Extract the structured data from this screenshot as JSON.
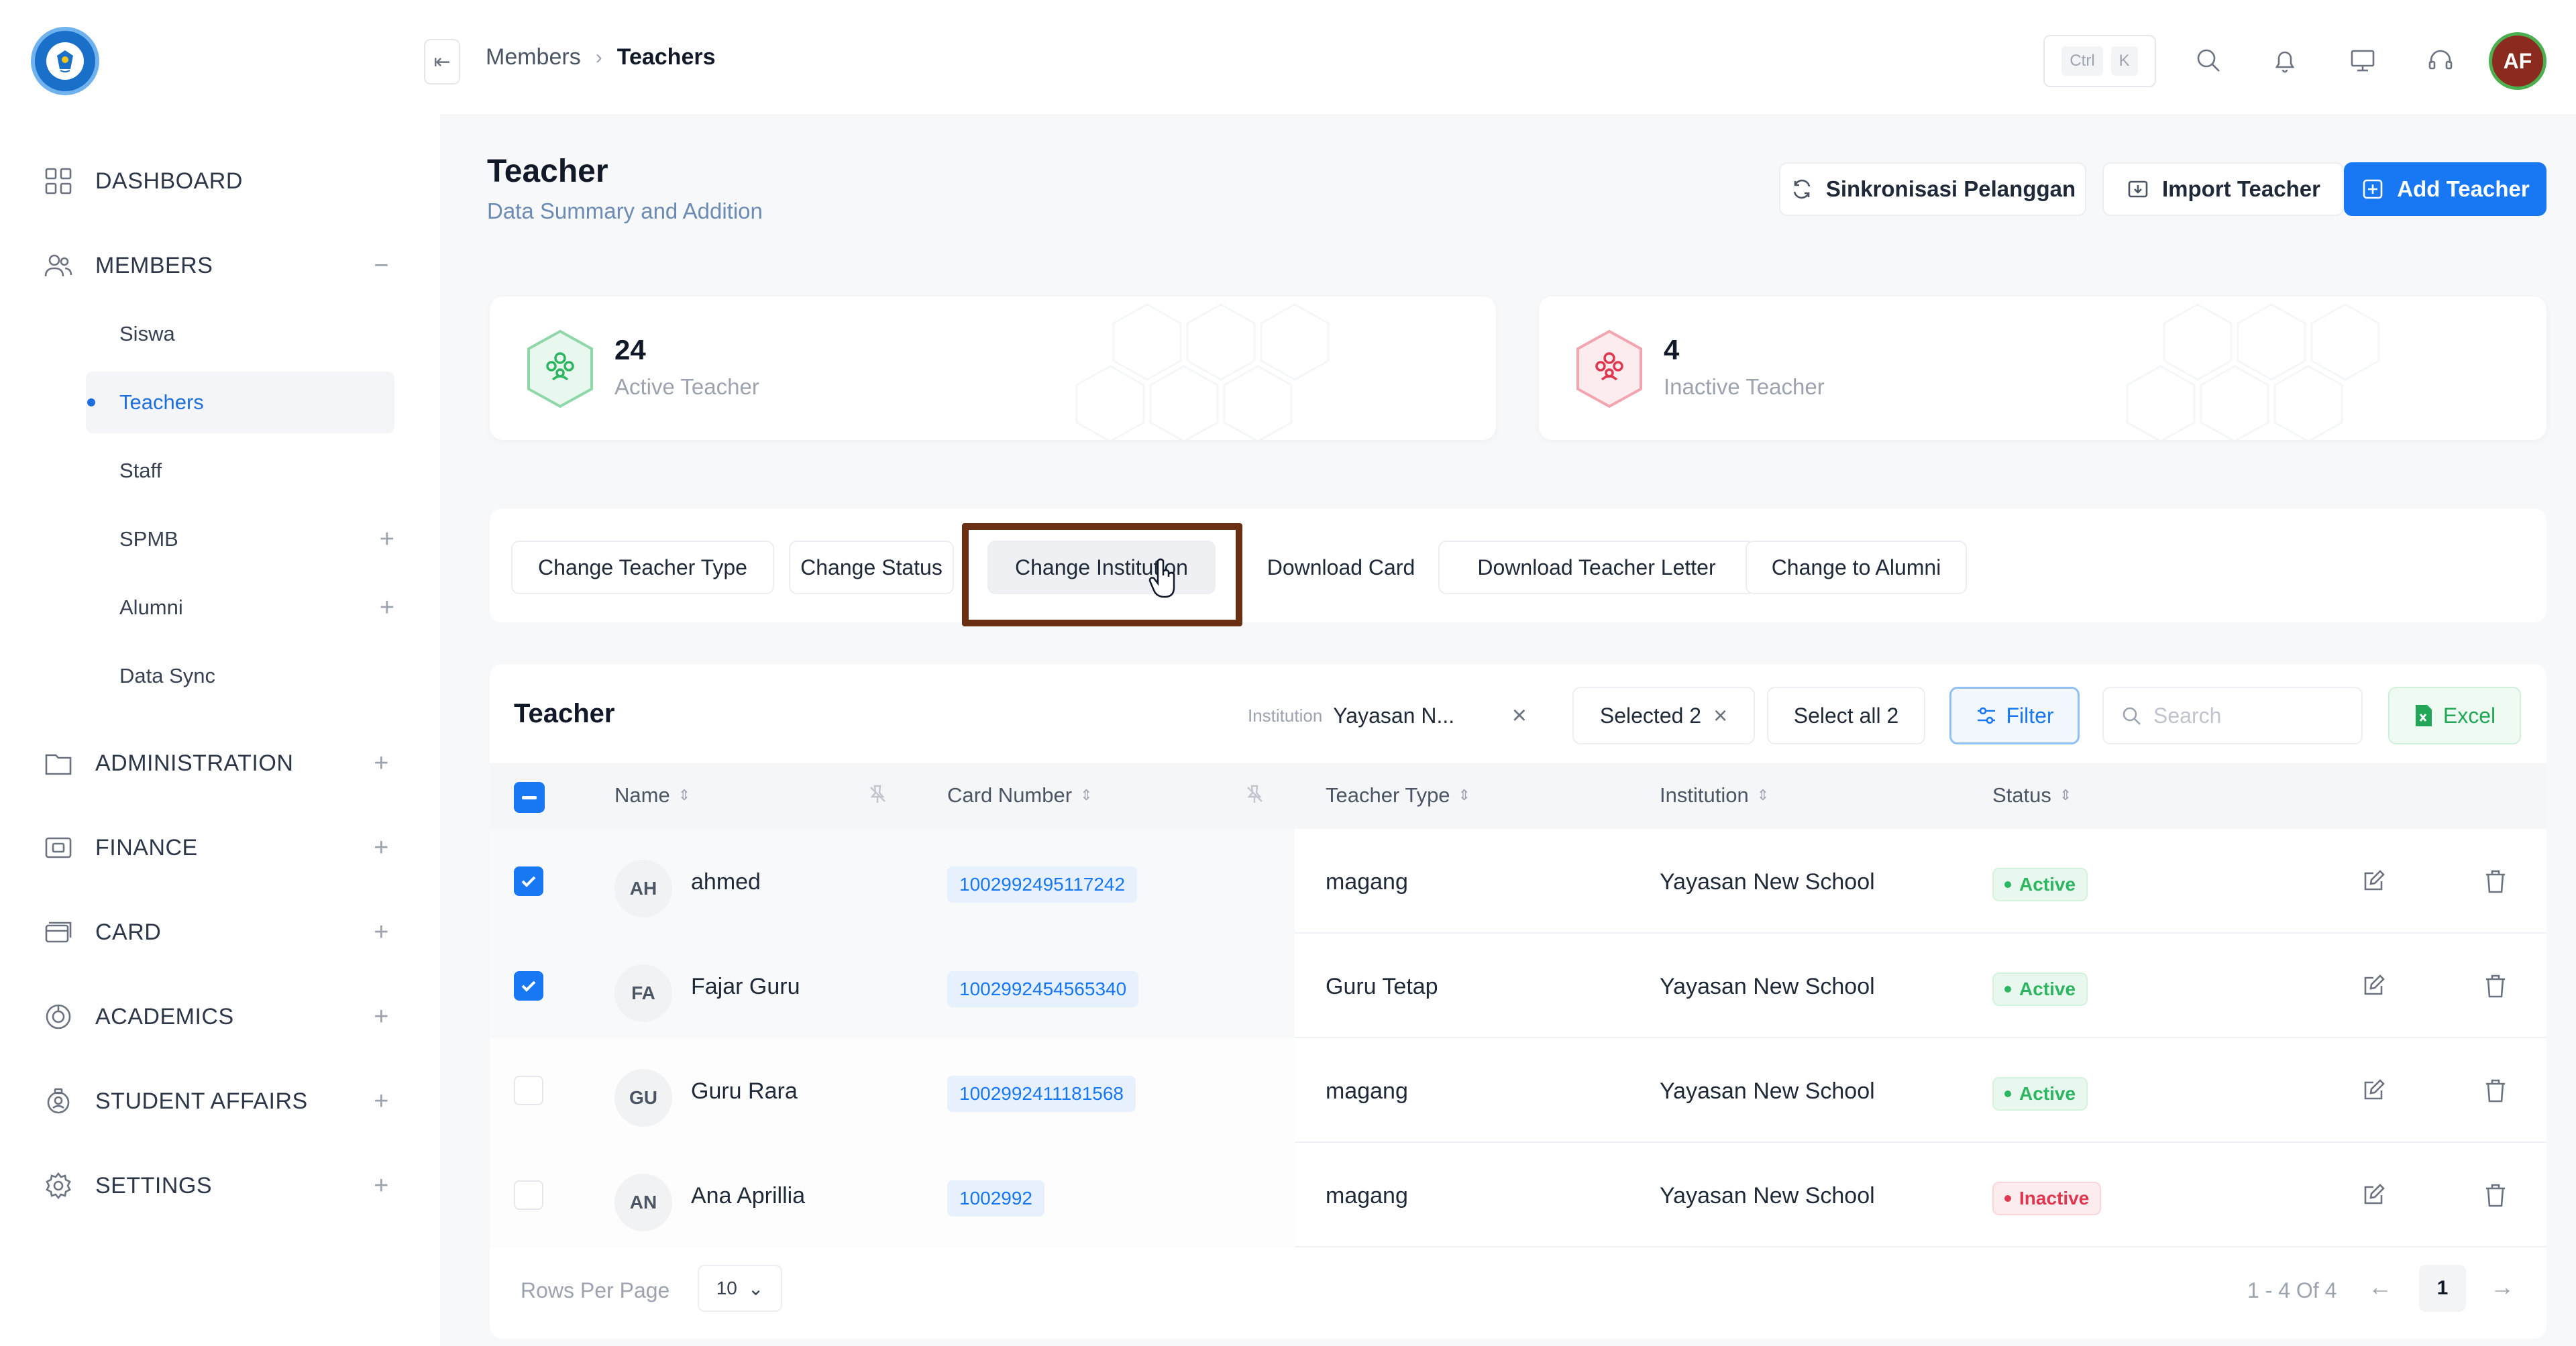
{
  "topbar": {
    "breadcrumb": [
      "Members",
      "Teachers"
    ],
    "shortcut_keys": [
      "Ctrl",
      "K"
    ],
    "avatar_initials": "AF",
    "icons": [
      "search-icon",
      "bell-icon",
      "monitor-icon",
      "headset-icon"
    ]
  },
  "sidebar": {
    "items": [
      {
        "label": "DASHBOARD",
        "icon": "grid-icon",
        "toggle": ""
      },
      {
        "label": "MEMBERS",
        "icon": "users-icon",
        "toggle": "−"
      },
      {
        "label": "ADMINISTRATION",
        "icon": "folder-icon",
        "toggle": "+"
      },
      {
        "label": "FINANCE",
        "icon": "wallet-icon",
        "toggle": "+"
      },
      {
        "label": "CARD",
        "icon": "card-icon",
        "toggle": "+"
      },
      {
        "label": "ACADEMICS",
        "icon": "academics-icon",
        "toggle": "+"
      },
      {
        "label": "STUDENT AFFAIRS",
        "icon": "student-icon",
        "toggle": "+"
      },
      {
        "label": "SETTINGS",
        "icon": "gear-icon",
        "toggle": "+"
      }
    ],
    "members_sub": [
      {
        "label": "Siswa",
        "toggle": ""
      },
      {
        "label": "Teachers",
        "toggle": ""
      },
      {
        "label": "Staff",
        "toggle": ""
      },
      {
        "label": "SPMB",
        "toggle": "+"
      },
      {
        "label": "Alumni",
        "toggle": "+"
      },
      {
        "label": "Data Sync",
        "toggle": ""
      }
    ]
  },
  "header": {
    "title": "Teacher",
    "subtitle": "Data Summary and Addition",
    "sync_label": "Sinkronisasi Pelanggan",
    "import_label": "Import Teacher",
    "add_label": "Add Teacher"
  },
  "stats": {
    "active": {
      "count": "24",
      "label": "Active Teacher"
    },
    "inactive": {
      "count": "4",
      "label": "Inactive Teacher"
    }
  },
  "actions": [
    "Change Teacher Type",
    "Change Status",
    "Change Institution",
    "Download Card",
    "Download Teacher Letter",
    "Change to Alumni"
  ],
  "table": {
    "title": "Teacher",
    "institution_filter_label": "Institution",
    "institution_filter_value": "Yayasan N...",
    "selected_label": "Selected 2",
    "select_all_label": "Select all  2",
    "filter_label": "Filter",
    "search_placeholder": "Search",
    "excel_label": "Excel",
    "columns": [
      "Name",
      "Card Number",
      "Teacher Type",
      "Institution",
      "Status"
    ],
    "rows": [
      {
        "initials": "AH",
        "name": "ahmed",
        "card": "1002992495117242",
        "type": "magang",
        "institution": "Yayasan New School",
        "status": "Active",
        "checked": true
      },
      {
        "initials": "FA",
        "name": "Fajar Guru",
        "card": "1002992454565340",
        "type": "Guru Tetap",
        "institution": "Yayasan New School",
        "status": "Active",
        "checked": true
      },
      {
        "initials": "GU",
        "name": "Guru Rara",
        "card": "1002992411181568",
        "type": "magang",
        "institution": "Yayasan New School",
        "status": "Active",
        "checked": false
      },
      {
        "initials": "AN",
        "name": "Ana Aprillia",
        "card": "1002992",
        "type": "magang",
        "institution": "Yayasan New School",
        "status": "Inactive",
        "checked": false
      }
    ],
    "rows_per_page_label": "Rows Per Page",
    "rows_per_page_value": "10",
    "pager_info": "1 - 4 Of 4",
    "current_page": "1"
  },
  "colors": {
    "accent": "#1877f2",
    "active": "#2db561",
    "inactive": "#e0364f",
    "highlight": "#6b2f14"
  }
}
